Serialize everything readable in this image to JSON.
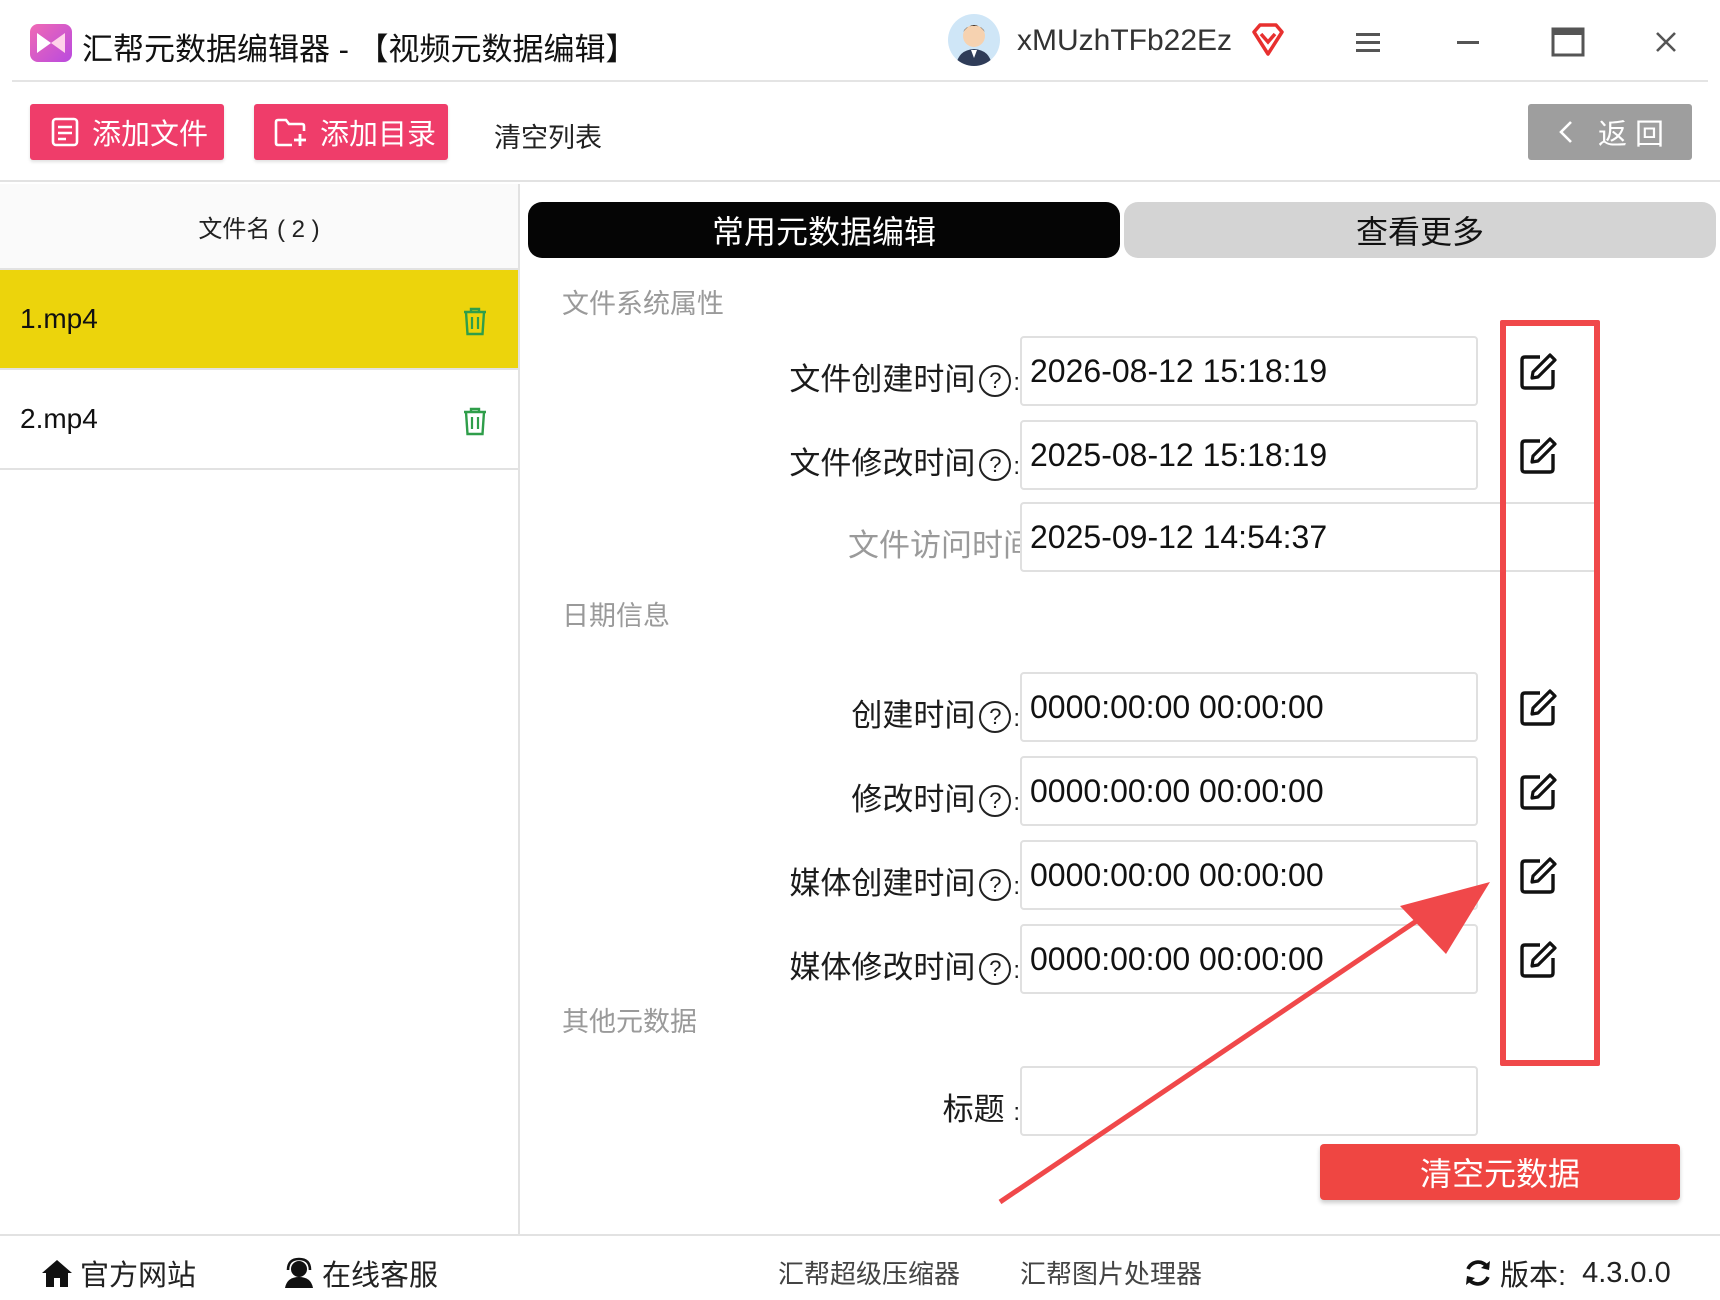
{
  "app": {
    "title": "汇帮元数据编辑器 - 【视频元数据编辑】",
    "username": "xMUzhTFb22Ez"
  },
  "toolbar": {
    "add_file": "添加文件",
    "add_folder": "添加目录",
    "clear_list": "清空列表",
    "back": "返 回"
  },
  "file_list": {
    "header": "文件名 ( 2 )",
    "items": [
      {
        "name": "1.mp4",
        "selected": true
      },
      {
        "name": "2.mp4",
        "selected": false
      }
    ]
  },
  "tabs": {
    "common": "常用元数据编辑",
    "more": "查看更多"
  },
  "sections": {
    "filesystem": "文件系统属性",
    "date": "日期信息",
    "other": "其他元数据"
  },
  "filesystem_rows": [
    {
      "label": "文件创建时间",
      "value": "2026-08-12 15:18:19"
    },
    {
      "label": "文件修改时间",
      "value": "2025-08-12 15:18:19"
    },
    {
      "label": "文件访问时间",
      "value": "2025-09-12 14:54:37"
    }
  ],
  "date_rows": [
    {
      "label": "创建时间",
      "value": "0000:00:00 00:00:00"
    },
    {
      "label": "修改时间",
      "value": "0000:00:00 00:00:00"
    },
    {
      "label": "媒体创建时间",
      "value": "0000:00:00 00:00:00"
    },
    {
      "label": "媒体修改时间",
      "value": "0000:00:00 00:00:00"
    }
  ],
  "other_rows": [
    {
      "label": "标题",
      "value": ""
    }
  ],
  "clear_metadata": "清空元数据",
  "footer": {
    "website": "官方网站",
    "support": "在线客服",
    "link1": "汇帮超级压缩器",
    "link2": "汇帮图片处理器",
    "version_label": "版本:",
    "version": "4.3.0.0"
  },
  "colors": {
    "accent_pink": "#ef3d6a",
    "selected_row": "#ecd40c",
    "annotation_red": "#f0484a",
    "clear_button": "#ef4642"
  }
}
